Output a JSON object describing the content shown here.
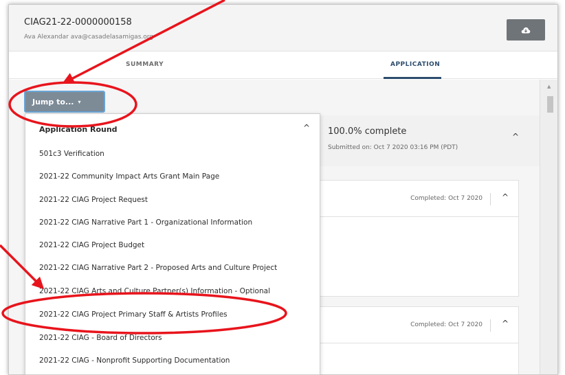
{
  "header": {
    "application_id": "CIAG21-22-0000000158",
    "applicant": "Ava Alexandar ava@casadelasamigas.org",
    "download_icon": "cloud-download-icon"
  },
  "tabs": [
    {
      "label": "SUMMARY",
      "active": false
    },
    {
      "label": "APPLICATION",
      "active": true
    }
  ],
  "jump": {
    "label": "Jump to...",
    "caret": "▾"
  },
  "dropdown": {
    "title": "Application Round",
    "collapse_glyph": "^",
    "items": [
      "501c3 Verification",
      "2021-22 Community Impact Arts Grant Main Page",
      "2021-22 CIAG Project Request",
      "2021-22 CIAG Narrative Part 1 - Organizational Information",
      "2021-22 CIAG Project Budget",
      "2021-22 CIAG Narrative Part 2 - Proposed Arts and Culture Project",
      "2021-22 CIAG Arts and Culture Partner(s) Information - Optional",
      "2021-22 CIAG Project Primary Staff & Artists Profiles",
      "2021-22 CIAG - Board of Directors",
      "2021-22 CIAG - Nonprofit Supporting Documentation"
    ]
  },
  "progress": {
    "percent_label": "100.0% complete",
    "submitted": "Submitted on: Oct 7 2020 03:16 PM (PDT)",
    "collapse_glyph": "^"
  },
  "cards": [
    {
      "status": "Completed: Oct 7 2020",
      "collapse_glyph": "^"
    },
    {
      "status": "Completed: Oct 7 2020",
      "collapse_glyph": "^"
    }
  ],
  "colors": {
    "annotation": "#e8141c",
    "accent": "#2d4c6d",
    "jump_button": "#7d8b97"
  }
}
